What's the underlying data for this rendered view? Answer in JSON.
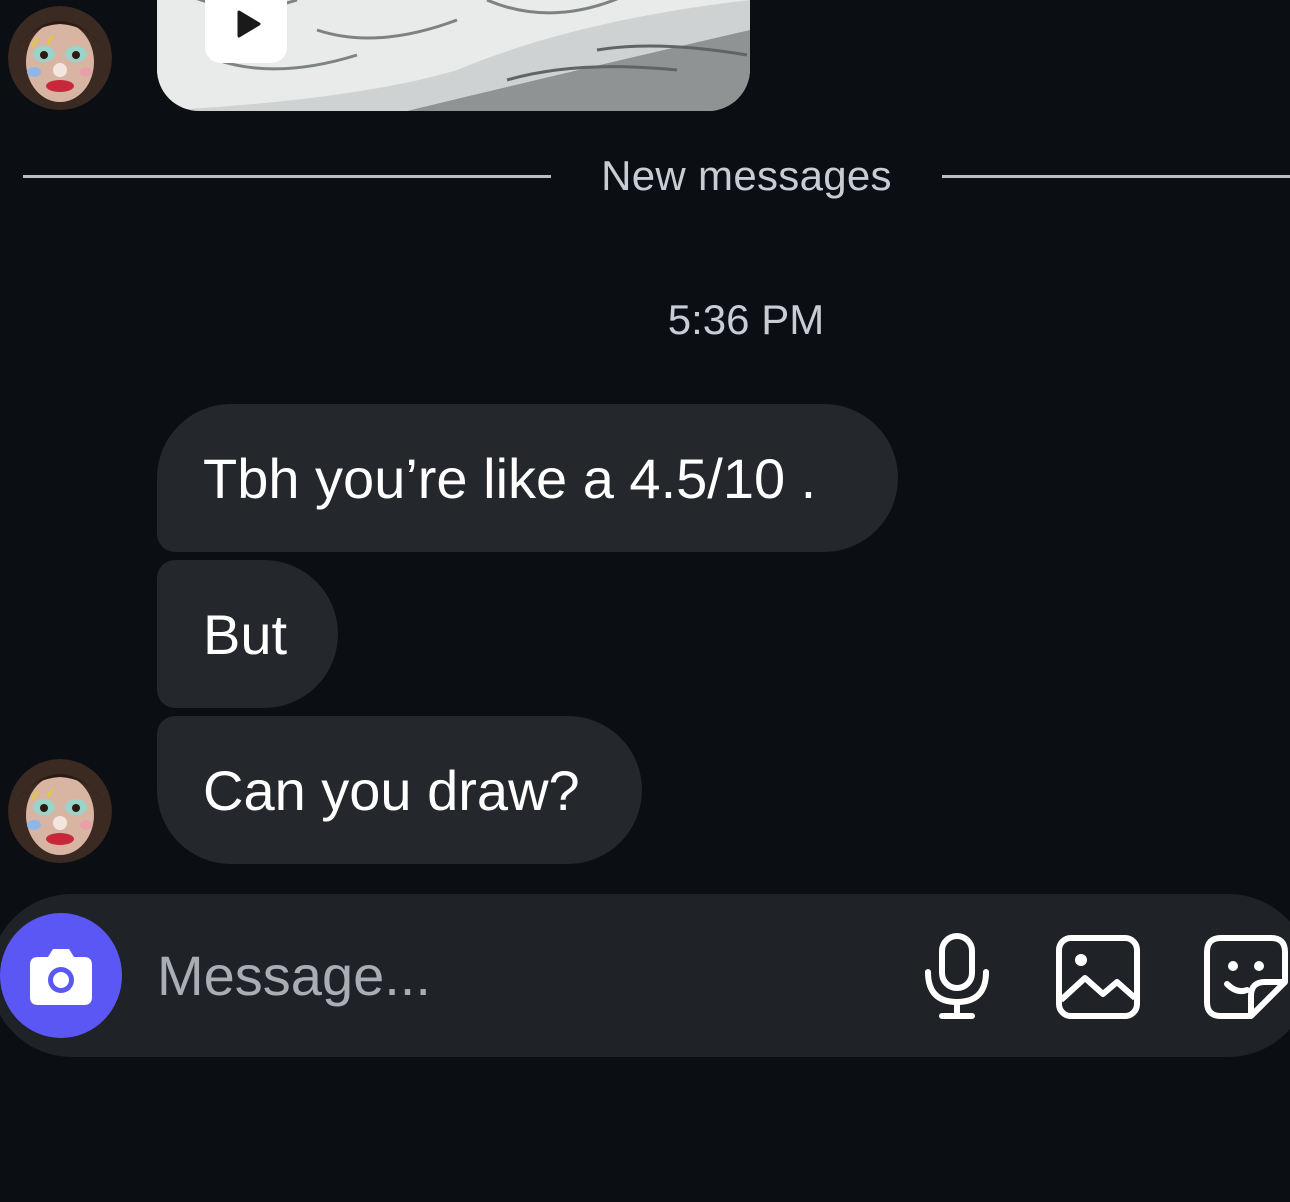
{
  "thread": {
    "divider_label": "New messages",
    "timestamp": "5:36 PM",
    "messages": [
      {
        "sender": "other",
        "text": "Tbh you’re like a 4.5/10 ."
      },
      {
        "sender": "other",
        "text": "But"
      },
      {
        "sender": "other",
        "text": "Can you draw?"
      }
    ],
    "media_preview": {
      "kind": "video",
      "icon": "play-icon"
    }
  },
  "composer": {
    "placeholder": "Message...",
    "value": "",
    "camera_icon": "camera-icon",
    "tools": [
      "microphone-icon",
      "gallery-icon",
      "sticker-icon"
    ]
  },
  "colors": {
    "background": "#0b0f14",
    "bubble": "#24272c",
    "composer": "#1f2226",
    "camera_accent": "#5b57f5",
    "muted_text": "#c8ccd3"
  }
}
